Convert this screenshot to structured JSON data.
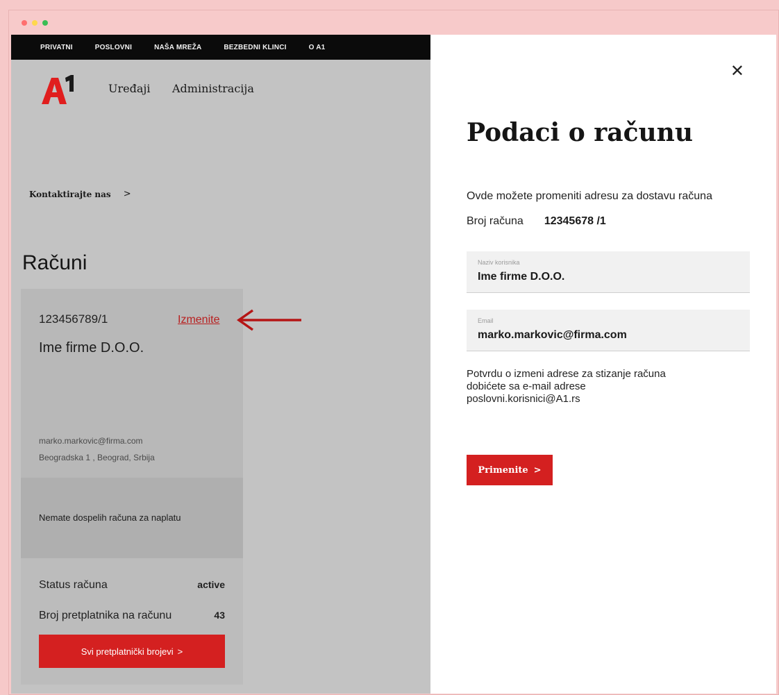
{
  "browser": {
    "dot_colors": [
      "#ff6f6f",
      "#ffd84d",
      "#3bbd55"
    ]
  },
  "topnav": {
    "items": [
      "PRIVATNI",
      "POSLOVNI",
      "NAŠA MREŽA",
      "BEZBEDNI KLINCI",
      "O A1"
    ]
  },
  "header": {
    "logo_text": "A1",
    "links": [
      "Uređaji",
      "Administracija"
    ]
  },
  "contact": {
    "label": "Kontaktirajte nas",
    "chevron": ">"
  },
  "page": {
    "title": "Računi"
  },
  "account_card": {
    "account_number": "123456789/1",
    "edit_link": "Izmenite",
    "company": "Ime firme D.O.O.",
    "email": "marko.markovic@firma.com",
    "address": "Beogradska 1 , Beograd, Srbija",
    "notice": "Nemate dospelih računa za naplatu",
    "status_label": "Status računa",
    "status_value": "active",
    "subscribers_label": "Broj pretplatnika na računu",
    "subscribers_value": "43",
    "all_numbers_button": "Svi pretplatnički brojevi",
    "button_chevron": ">"
  },
  "drawer": {
    "close_symbol": "✕",
    "title": "Podaci o računu",
    "description": "Ovde možete promeniti adresu za dostavu računa",
    "account_label": "Broj računa",
    "account_value": "12345678 /1",
    "name_field_label": "Naziv korisnika",
    "name_field_value": "Ime firme D.O.O.",
    "email_field_label": "Email",
    "email_field_value": "marko.markovic@firma.com",
    "confirm_lines": [
      "Potvrdu o izmeni adrese za stizanje računa",
      "dobićete sa e-mail adrese",
      "poslovni.korisnici@A1.rs"
    ],
    "apply_button": "Primenite",
    "apply_chevron": ">"
  },
  "colors": {
    "accent_red": "#d42020",
    "link_red": "#b81f1f",
    "overlay_gray": "#c3c3c3"
  }
}
